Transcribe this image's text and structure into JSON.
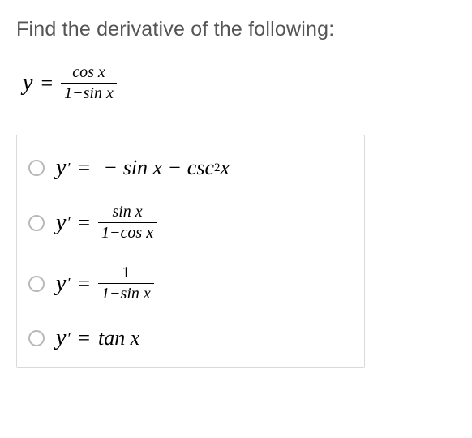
{
  "prompt": "Find the derivative of the following:",
  "equation": {
    "lhs": "y",
    "eq": "=",
    "num": "cos x",
    "den": "1−sin x"
  },
  "options": [
    {
      "yprime": "y",
      "eq": "=",
      "pre_minus": "−",
      "term1": "sin x",
      "mid_minus": "−",
      "term2a": "csc",
      "sup": "2",
      "term2b": " x"
    },
    {
      "yprime": "y",
      "eq": "=",
      "num": "sin x",
      "den": "1−cos x"
    },
    {
      "yprime": "y",
      "eq": "=",
      "num": "1",
      "den": "1−sin x"
    },
    {
      "yprime": "y",
      "eq": "=",
      "term": "tan x"
    }
  ]
}
